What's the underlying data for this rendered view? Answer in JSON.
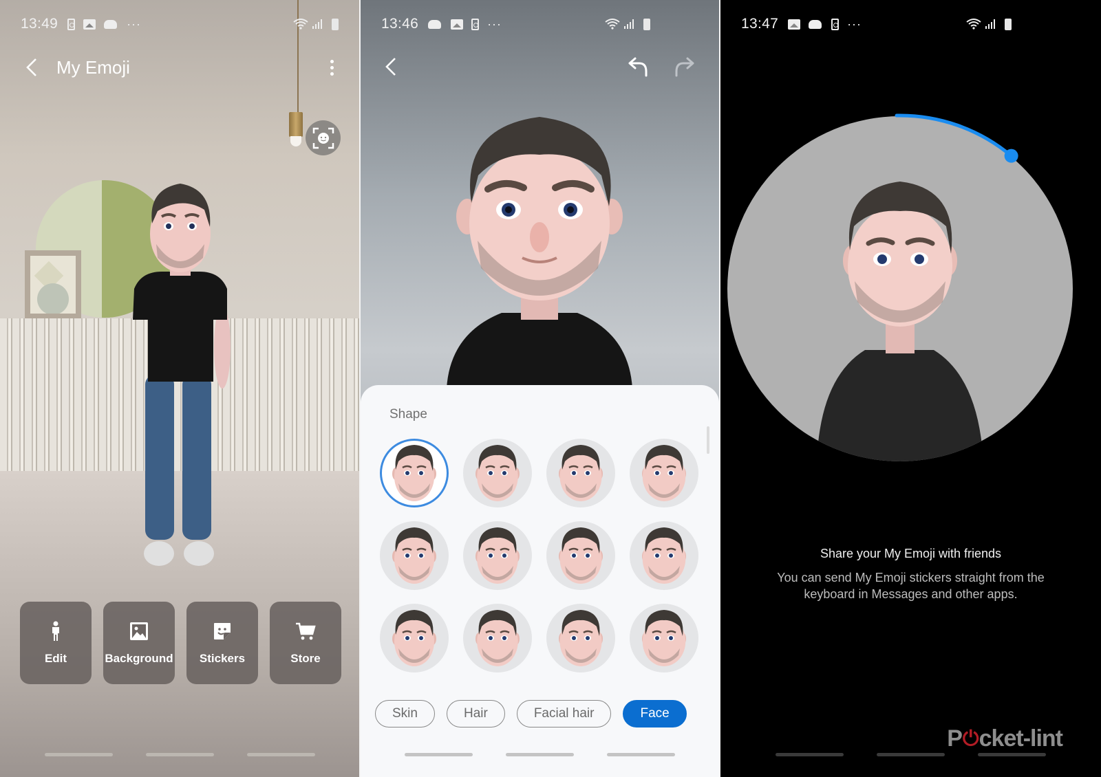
{
  "panels": {
    "home": {
      "status_bar": {
        "time": "13:49",
        "notification_icons": [
          "speaker-icon",
          "gallery-icon",
          "game-launcher-icon",
          "more-notifications-icon"
        ],
        "system_icons": [
          "wifi-icon",
          "signal-icon",
          "battery-icon"
        ],
        "more": "···"
      },
      "header": {
        "title": "My Emoji",
        "back_icon": "chevron-left-icon",
        "menu_icon": "kebab-menu-icon"
      },
      "face_scan_icon": "face-scan-icon",
      "actions": [
        {
          "label": "Edit",
          "icon": "person-icon"
        },
        {
          "label": "Background",
          "icon": "image-icon"
        },
        {
          "label": "Stickers",
          "icon": "sticker-icon"
        },
        {
          "label": "Store",
          "icon": "cart-icon"
        }
      ]
    },
    "editor": {
      "status_bar": {
        "time": "13:46",
        "notification_icons": [
          "game-launcher-icon",
          "gallery-icon",
          "speaker-icon",
          "more-notifications-icon"
        ],
        "system_icons": [
          "wifi-icon",
          "signal-icon",
          "battery-icon"
        ],
        "more": "···"
      },
      "header": {
        "back_icon": "chevron-left-icon",
        "undo_icon": "undo-icon",
        "redo_icon": "redo-icon",
        "redo_enabled": false
      },
      "section_title": "Shape",
      "shape_options": {
        "count": 12,
        "selected_index": 0
      },
      "categories": [
        {
          "label": "Skin",
          "active": false
        },
        {
          "label": "Hair",
          "active": false
        },
        {
          "label": "Facial hair",
          "active": false
        },
        {
          "label": "Face",
          "active": true
        }
      ]
    },
    "share": {
      "status_bar": {
        "time": "13:47",
        "notification_icons": [
          "gallery-icon",
          "game-launcher-icon",
          "speaker-icon",
          "more-notifications-icon"
        ],
        "system_icons": [
          "wifi-icon",
          "signal-icon",
          "battery-icon"
        ],
        "more": "···"
      },
      "progress_fraction": 0.19,
      "title": "Share your My Emoji with friends",
      "body": "You can send My Emoji stickers straight from the keyboard in Messages and other apps."
    }
  },
  "watermark": {
    "prefix": "P",
    "power_glyph": "⏻",
    "suffix": "cket-lint"
  },
  "colors": {
    "accent": "#0b6ed0",
    "selected_ring": "#3d8be0",
    "progress": "#1a8cf0",
    "watermark_red": "#b21c25"
  }
}
